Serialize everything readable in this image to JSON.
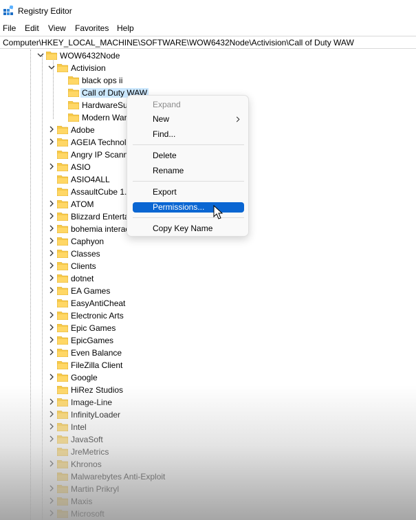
{
  "window": {
    "title": "Registry Editor"
  },
  "menu": [
    "File",
    "Edit",
    "View",
    "Favorites",
    "Help"
  ],
  "address": "Computer\\HKEY_LOCAL_MACHINE\\SOFTWARE\\WOW6432Node\\Activision\\Call of Duty WAW",
  "tree": [
    {
      "label": "WOW6432Node",
      "level": 0,
      "chevron": "down"
    },
    {
      "label": "Activision",
      "level": 1,
      "chevron": "down"
    },
    {
      "label": "black ops ii",
      "level": 2,
      "chevron": "none"
    },
    {
      "label": "Call of Duty WAW",
      "level": 2,
      "chevron": "none",
      "selected": true
    },
    {
      "label": "HardwareSurvey",
      "level": 2,
      "chevron": "none"
    },
    {
      "label": "Modern Warfare",
      "level": 2,
      "chevron": "none"
    },
    {
      "label": "Adobe",
      "level": 1,
      "chevron": "right"
    },
    {
      "label": "AGEIA Technologies",
      "level": 1,
      "chevron": "right"
    },
    {
      "label": "Angry IP Scanner",
      "level": 1,
      "chevron": "none"
    },
    {
      "label": "ASIO",
      "level": 1,
      "chevron": "right"
    },
    {
      "label": "ASIO4ALL",
      "level": 1,
      "chevron": "none"
    },
    {
      "label": "AssaultCube 1.3",
      "level": 1,
      "chevron": "none"
    },
    {
      "label": "ATOM",
      "level": 1,
      "chevron": "right"
    },
    {
      "label": "Blizzard Entertainment",
      "level": 1,
      "chevron": "right"
    },
    {
      "label": "bohemia interactive",
      "level": 1,
      "chevron": "right"
    },
    {
      "label": "Caphyon",
      "level": 1,
      "chevron": "right"
    },
    {
      "label": "Classes",
      "level": 1,
      "chevron": "right"
    },
    {
      "label": "Clients",
      "level": 1,
      "chevron": "right"
    },
    {
      "label": "dotnet",
      "level": 1,
      "chevron": "right"
    },
    {
      "label": "EA Games",
      "level": 1,
      "chevron": "right"
    },
    {
      "label": "EasyAntiCheat",
      "level": 1,
      "chevron": "none"
    },
    {
      "label": "Electronic Arts",
      "level": 1,
      "chevron": "right"
    },
    {
      "label": "Epic Games",
      "level": 1,
      "chevron": "right"
    },
    {
      "label": "EpicGames",
      "level": 1,
      "chevron": "right"
    },
    {
      "label": "Even Balance",
      "level": 1,
      "chevron": "right"
    },
    {
      "label": "FileZilla Client",
      "level": 1,
      "chevron": "none"
    },
    {
      "label": "Google",
      "level": 1,
      "chevron": "right"
    },
    {
      "label": "HiRez Studios",
      "level": 1,
      "chevron": "none"
    },
    {
      "label": "Image-Line",
      "level": 1,
      "chevron": "right"
    },
    {
      "label": "InfinityLoader",
      "level": 1,
      "chevron": "right"
    },
    {
      "label": "Intel",
      "level": 1,
      "chevron": "right"
    },
    {
      "label": "JavaSoft",
      "level": 1,
      "chevron": "right"
    },
    {
      "label": "JreMetrics",
      "level": 1,
      "chevron": "none"
    },
    {
      "label": "Khronos",
      "level": 1,
      "chevron": "right"
    },
    {
      "label": "Malwarebytes Anti-Exploit",
      "level": 1,
      "chevron": "none"
    },
    {
      "label": "Martin Prikryl",
      "level": 1,
      "chevron": "right"
    },
    {
      "label": "Maxis",
      "level": 1,
      "chevron": "right"
    },
    {
      "label": "Microsoft",
      "level": 1,
      "chevron": "right"
    }
  ],
  "context_menu": {
    "items": [
      {
        "label": "Expand",
        "state": "disabled",
        "submenu": false
      },
      {
        "label": "New",
        "state": "normal",
        "submenu": true
      },
      {
        "label": "Find...",
        "state": "normal",
        "submenu": false
      },
      {
        "label": "Delete",
        "state": "normal",
        "submenu": false
      },
      {
        "label": "Rename",
        "state": "normal",
        "submenu": false
      },
      {
        "label": "Export",
        "state": "normal",
        "submenu": false
      },
      {
        "label": "Permissions...",
        "state": "highlighted",
        "submenu": false
      },
      {
        "label": "Copy Key Name",
        "state": "normal",
        "submenu": false
      }
    ]
  },
  "colors": {
    "selection_background": "#cce8ff",
    "menu_highlight": "#0a66d2",
    "folder": "#f6c94a"
  },
  "icons": [
    "registry-editor-icon",
    "folder-icon",
    "chevron-down-icon",
    "chevron-right-icon",
    "submenu-arrow-icon",
    "mouse-pointer-icon"
  ]
}
